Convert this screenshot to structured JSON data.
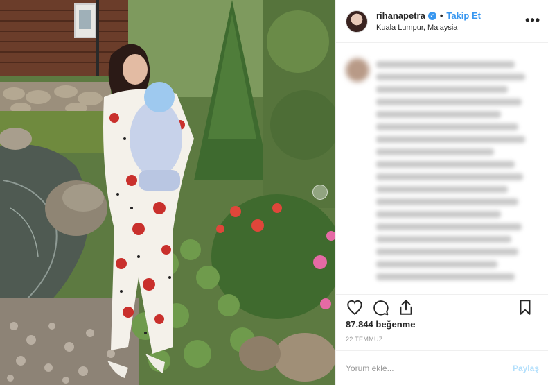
{
  "post": {
    "username": "rihanapetra",
    "verified": true,
    "follow_label": "Takip Et",
    "separator": "•",
    "location": "Kuala Lumpur, Malaysia",
    "more_label": "•••",
    "likes": "87.844 beğenme",
    "date": "22 TEMMUZ",
    "comment_placeholder": "Yorum ekle...",
    "post_label": "Paylaş"
  },
  "icons": {
    "verified": "verified-badge-icon",
    "like": "heart-icon",
    "comment": "comment-bubble-icon",
    "share": "share-arrow-icon",
    "save": "bookmark-icon",
    "more": "more-options-icon"
  },
  "colors": {
    "accent": "#3897f0",
    "post_button_disabled": "#b2dffc",
    "text": "#262626",
    "muted": "#999999",
    "border": "#efefef"
  }
}
